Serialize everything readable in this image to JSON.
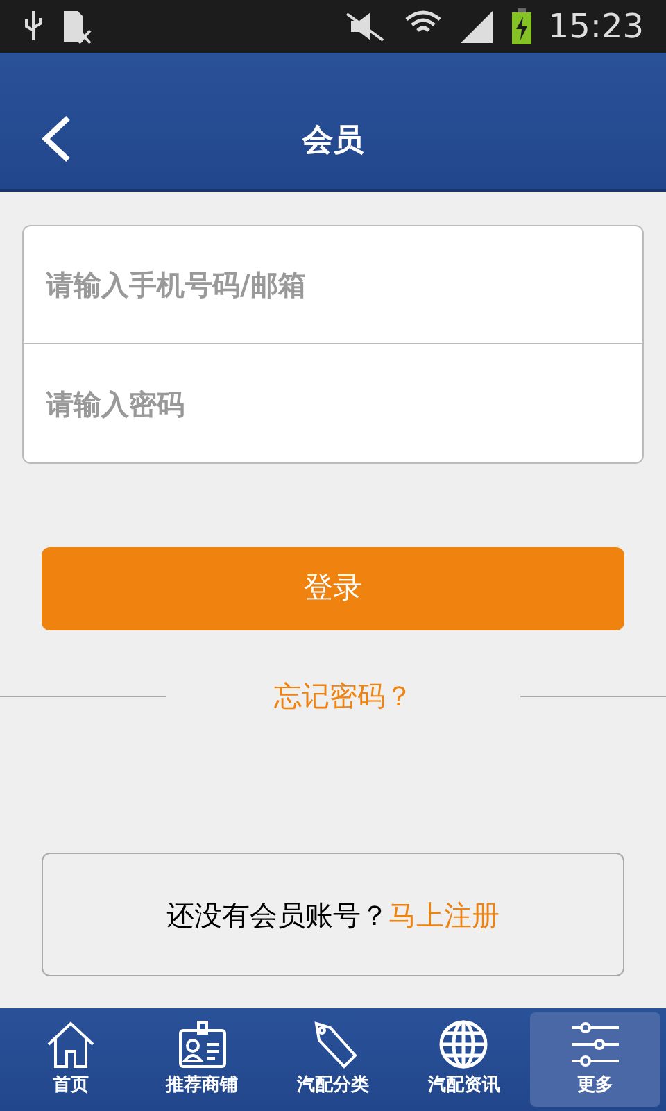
{
  "status_bar": {
    "time": "15:23"
  },
  "header": {
    "title": "会员"
  },
  "form": {
    "fields": [
      {
        "placeholder": "请输入手机号码/邮箱"
      },
      {
        "placeholder": "请输入密码"
      }
    ]
  },
  "login_button": "登录",
  "forgot_link": "忘记密码？",
  "register": {
    "text": "还没有会员账号？",
    "link": "马上注册"
  },
  "tabs": [
    {
      "label": "首页",
      "selected": false
    },
    {
      "label": "推荐商铺",
      "selected": false
    },
    {
      "label": "汽配分类",
      "selected": false
    },
    {
      "label": "汽配资讯",
      "selected": false
    },
    {
      "label": "更多",
      "selected": true
    }
  ]
}
